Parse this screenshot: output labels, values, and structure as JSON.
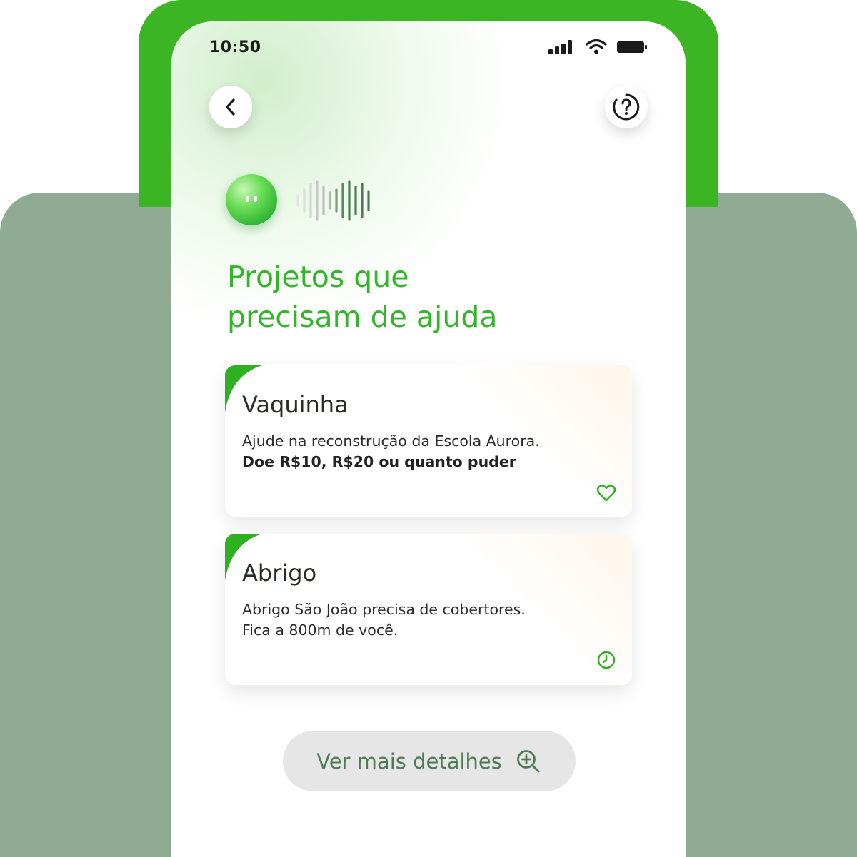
{
  "status_bar": {
    "time": "10:50"
  },
  "title": {
    "line1": "Projetos que",
    "line2": "precisam de ajuda"
  },
  "cards": [
    {
      "title": "Vaquinha",
      "line1": "Ajude na reconstrução da Escola Aurora.",
      "line2": "Doe R$10, R$20 ou quanto puder",
      "icon": "heart-icon"
    },
    {
      "title": "Abrigo",
      "line1": "Abrigo São João precisa de cobertores.",
      "line2": "Fica a 800m de você.",
      "icon": "clock-icon"
    }
  ],
  "more_button": {
    "label": "Ver mais detalhes",
    "icon": "zoom-in-icon"
  },
  "colors": {
    "brand_green": "#33b52a",
    "backdrop": "#8fab94",
    "button_text": "#4e7b55"
  }
}
